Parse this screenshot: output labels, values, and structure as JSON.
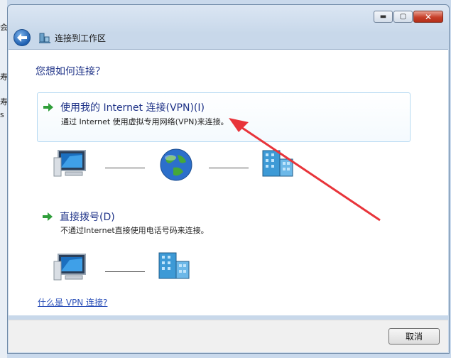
{
  "window": {
    "title": "连接到工作区",
    "controls": {
      "minimize": "▬",
      "maximize": "▢",
      "close": "✕"
    }
  },
  "background_fragments": [
    "会",
    "寿",
    "寿",
    "s"
  ],
  "main": {
    "question": "您想如何连接？",
    "options": [
      {
        "title": "使用我的 Internet 连接(VPN)(I)",
        "description": "通过 Internet 使用虚拟专用网络(VPN)来连接。",
        "highlighted": true
      },
      {
        "title": "直接拨号(D)",
        "description": "不通过Internet直接使用电话号码来连接。",
        "highlighted": false
      }
    ],
    "help_link": "什么是 VPN 连接?"
  },
  "footer": {
    "cancel_label": "取消"
  },
  "colors": {
    "accent_text": "#1e3287",
    "link": "#2a4fb8",
    "annotation_arrow": "#e8343a",
    "option_arrow": "#2f9e3a"
  },
  "icons": [
    "back-arrow-icon",
    "workplace-network-icon",
    "computer-icon",
    "globe-icon",
    "office-building-icon",
    "green-arrow-icon"
  ]
}
